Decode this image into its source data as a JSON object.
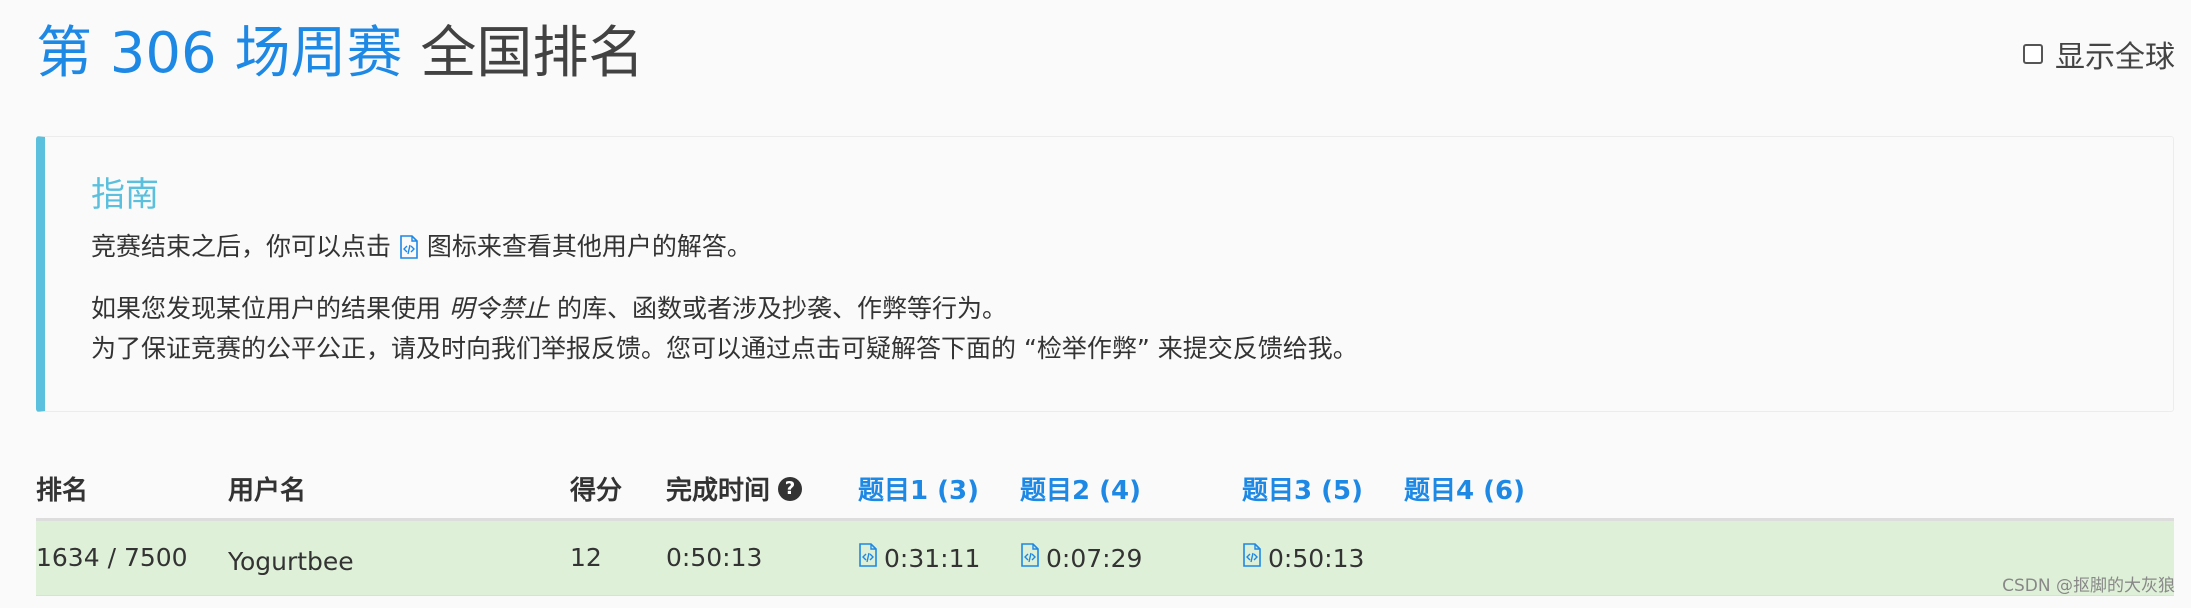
{
  "header": {
    "contest_name": "第 306 场周赛",
    "rank_title": "全国排名",
    "global_label": "显示全球"
  },
  "guide": {
    "title": "指南",
    "line1_before": "竞赛结束之后，你可以点击",
    "line1_after": "图标来查看其他用户的解答。",
    "line2_before": "如果您发现某位用户的结果使用",
    "line2_italic": "明令禁止",
    "line2_after": "的库、函数或者涉及抄袭、作弊等行为。",
    "line3": "为了保证竞赛的公平公正，请及时向我们举报反馈。您可以通过点击可疑解答下面的 “检举作弊” 来提交反馈给我。"
  },
  "table": {
    "headers": {
      "rank": "排名",
      "username": "用户名",
      "score": "得分",
      "finish_time": "完成时间",
      "q1": "题目1 (3)",
      "q2": "题目2 (4)",
      "q3": "题目3 (5)",
      "q4": "题目4 (6)"
    },
    "rows": [
      {
        "rank": "1634 / 7500",
        "username": "Yogurtbee",
        "score": "12",
        "finish_time": "0:50:13",
        "q1": "0:31:11",
        "q2": "0:07:29",
        "q3": "0:50:13",
        "q4": ""
      }
    ]
  },
  "watermark": "CSDN @抠脚的大灰狼",
  "colors": {
    "accent": "#1e88e5",
    "guide_border": "#5bc0de",
    "row_highlight": "#dff0d8"
  }
}
